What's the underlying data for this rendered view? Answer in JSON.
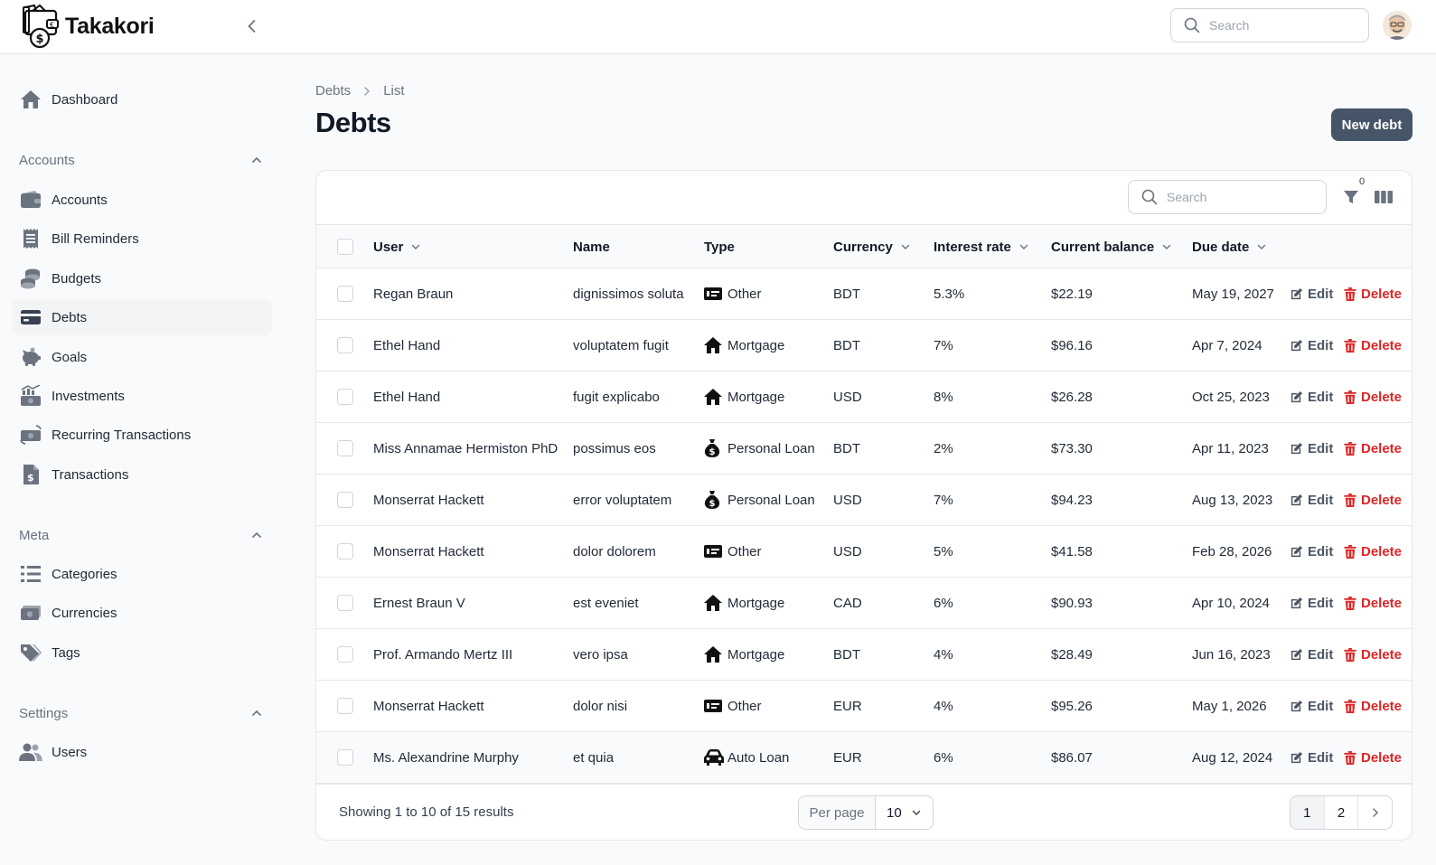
{
  "app": {
    "name": "Takakori"
  },
  "topbar": {
    "search_placeholder": "Search"
  },
  "sidebar": {
    "dashboard": "Dashboard",
    "groups": {
      "accounts": "Accounts",
      "meta": "Meta",
      "settings": "Settings"
    },
    "items": {
      "accounts": "Accounts",
      "bill_reminders": "Bill Reminders",
      "budgets": "Budgets",
      "debts": "Debts",
      "goals": "Goals",
      "investments": "Investments",
      "recurring": "Recurring Transactions",
      "transactions": "Transactions",
      "categories": "Categories",
      "currencies": "Currencies",
      "tags": "Tags",
      "users": "Users"
    }
  },
  "breadcrumb": {
    "parent": "Debts",
    "current": "List"
  },
  "page": {
    "title": "Debts",
    "new_button": "New debt"
  },
  "table": {
    "search_placeholder": "Search",
    "filter_count": "0",
    "headers": {
      "user": "User",
      "name": "Name",
      "type": "Type",
      "currency": "Currency",
      "interest": "Interest rate",
      "balance": "Current balance",
      "due": "Due date"
    },
    "actions": {
      "edit": "Edit",
      "delete": "Delete"
    },
    "rows": [
      {
        "user": "Regan Braun",
        "name": "dignissimos soluta",
        "type": "Other",
        "type_icon": "card-icon",
        "currency": "BDT",
        "interest": "5.3%",
        "balance": "$22.19",
        "due": "May 19, 2027"
      },
      {
        "user": "Ethel Hand",
        "name": "voluptatem fugit",
        "type": "Mortgage",
        "type_icon": "house-icon",
        "currency": "BDT",
        "interest": "7%",
        "balance": "$96.16",
        "due": "Apr 7, 2024"
      },
      {
        "user": "Ethel Hand",
        "name": "fugit explicabo",
        "type": "Mortgage",
        "type_icon": "house-icon",
        "currency": "USD",
        "interest": "8%",
        "balance": "$26.28",
        "due": "Oct 25, 2023"
      },
      {
        "user": "Miss Annamae Hermiston PhD",
        "name": "possimus eos",
        "type": "Personal Loan",
        "type_icon": "money-bag-icon",
        "currency": "BDT",
        "interest": "2%",
        "balance": "$73.30",
        "due": "Apr 11, 2023"
      },
      {
        "user": "Monserrat Hackett",
        "name": "error voluptatem",
        "type": "Personal Loan",
        "type_icon": "money-bag-icon",
        "currency": "USD",
        "interest": "7%",
        "balance": "$94.23",
        "due": "Aug 13, 2023"
      },
      {
        "user": "Monserrat Hackett",
        "name": "dolor dolorem",
        "type": "Other",
        "type_icon": "card-icon",
        "currency": "USD",
        "interest": "5%",
        "balance": "$41.58",
        "due": "Feb 28, 2026"
      },
      {
        "user": "Ernest Braun V",
        "name": "est eveniet",
        "type": "Mortgage",
        "type_icon": "house-icon",
        "currency": "CAD",
        "interest": "6%",
        "balance": "$90.93",
        "due": "Apr 10, 2024"
      },
      {
        "user": "Prof. Armando Mertz III",
        "name": "vero ipsa",
        "type": "Mortgage",
        "type_icon": "house-icon",
        "currency": "BDT",
        "interest": "4%",
        "balance": "$28.49",
        "due": "Jun 16, 2023"
      },
      {
        "user": "Monserrat Hackett",
        "name": "dolor nisi",
        "type": "Other",
        "type_icon": "card-icon",
        "currency": "EUR",
        "interest": "4%",
        "balance": "$95.26",
        "due": "May 1, 2026"
      },
      {
        "user": "Ms. Alexandrine Murphy",
        "name": "et quia",
        "type": "Auto Loan",
        "type_icon": "car-icon",
        "currency": "EUR",
        "interest": "6%",
        "balance": "$86.07",
        "due": "Aug 12, 2024"
      }
    ]
  },
  "footer": {
    "summary": "Showing 1 to 10 of 15 results",
    "per_page_label": "Per page",
    "per_page_value": "10",
    "pages": [
      "1",
      "2"
    ]
  },
  "colors": {
    "primary_button": "#475569",
    "danger": "#dc2626",
    "active_nav": "#f3f4f6"
  }
}
